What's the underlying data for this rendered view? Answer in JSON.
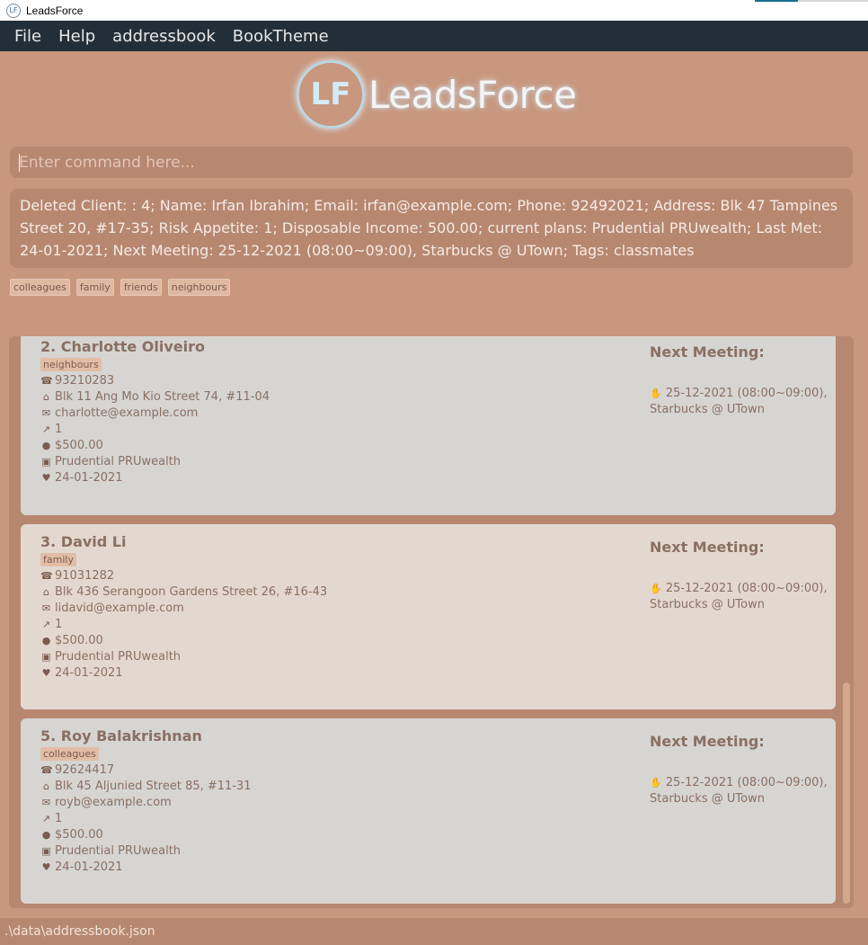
{
  "window": {
    "title": "LeadsForce",
    "app_icon_text": "LF"
  },
  "menu": [
    "File",
    "Help",
    "addressbook",
    "BookTheme"
  ],
  "logo": {
    "mark": "LF",
    "text": "LeadsForce"
  },
  "command_box": {
    "placeholder": "Enter command here...",
    "value": ""
  },
  "result": {
    "text": "Deleted Client: : 4; Name: Irfan Ibrahim; Email: irfan@example.com; Phone: 92492021; Address: Blk 47 Tampines Street 20, #17-35; Risk Appetite: 1; Disposable Income: 500.00; current plans: Prudential PRUwealth; Last Met: 24-01-2021; Next Meeting: 25-12-2021 (08:00~09:00), Starbucks @ UTown; Tags: classmates"
  },
  "tag_filter": [
    "colleagues",
    "family",
    "friends",
    "neighbours"
  ],
  "clients": [
    {
      "index_name": "2.  Charlotte Oliveiro",
      "tag": "neighbours",
      "phone": "93210283",
      "address": "Blk 11 Ang Mo Kio Street 74, #11-04",
      "email": "charlotte@example.com",
      "risk": "1",
      "income": "$500.00",
      "plan": "Prudential PRUwealth",
      "last_met": "24-01-2021",
      "next_meeting_label": "Next Meeting:",
      "next_meeting_line1": "25-12-2021 (08:00~09:00),",
      "next_meeting_line2": "Starbucks @ UTown"
    },
    {
      "index_name": "3.  David Li",
      "tag": "family",
      "phone": "91031282",
      "address": "Blk 436 Serangoon Gardens Street 26, #16-43",
      "email": "lidavid@example.com",
      "risk": "1",
      "income": "$500.00",
      "plan": "Prudential PRUwealth",
      "last_met": "24-01-2021",
      "next_meeting_label": "Next Meeting:",
      "next_meeting_line1": "25-12-2021 (08:00~09:00),",
      "next_meeting_line2": "Starbucks @ UTown"
    },
    {
      "index_name": "5.  Roy Balakrishnan",
      "tag": "colleagues",
      "phone": "92624417",
      "address": "Blk 45 Aljunied Street 85, #11-31",
      "email": "royb@example.com",
      "risk": "1",
      "income": "$500.00",
      "plan": "Prudential PRUwealth",
      "last_met": "24-01-2021",
      "next_meeting_label": "Next Meeting:",
      "next_meeting_line1": "25-12-2021 (08:00~09:00),",
      "next_meeting_line2": "Starbucks @ UTown"
    }
  ],
  "status_bar": {
    "path": ".\\data\\addressbook.json"
  },
  "icons": {
    "phone": "phone-icon",
    "address": "home-icon",
    "email": "mail-icon",
    "risk": "chart-icon",
    "income": "money-bag-icon",
    "plan": "bank-icon",
    "last_met": "heart-icon",
    "next_meeting": "handshake-icon"
  },
  "colors": {
    "background": "#c8977d",
    "panel": "#b78770",
    "menubar": "#232f38",
    "card": "#d6d5d2",
    "card_alt": "#e3d8cf"
  }
}
